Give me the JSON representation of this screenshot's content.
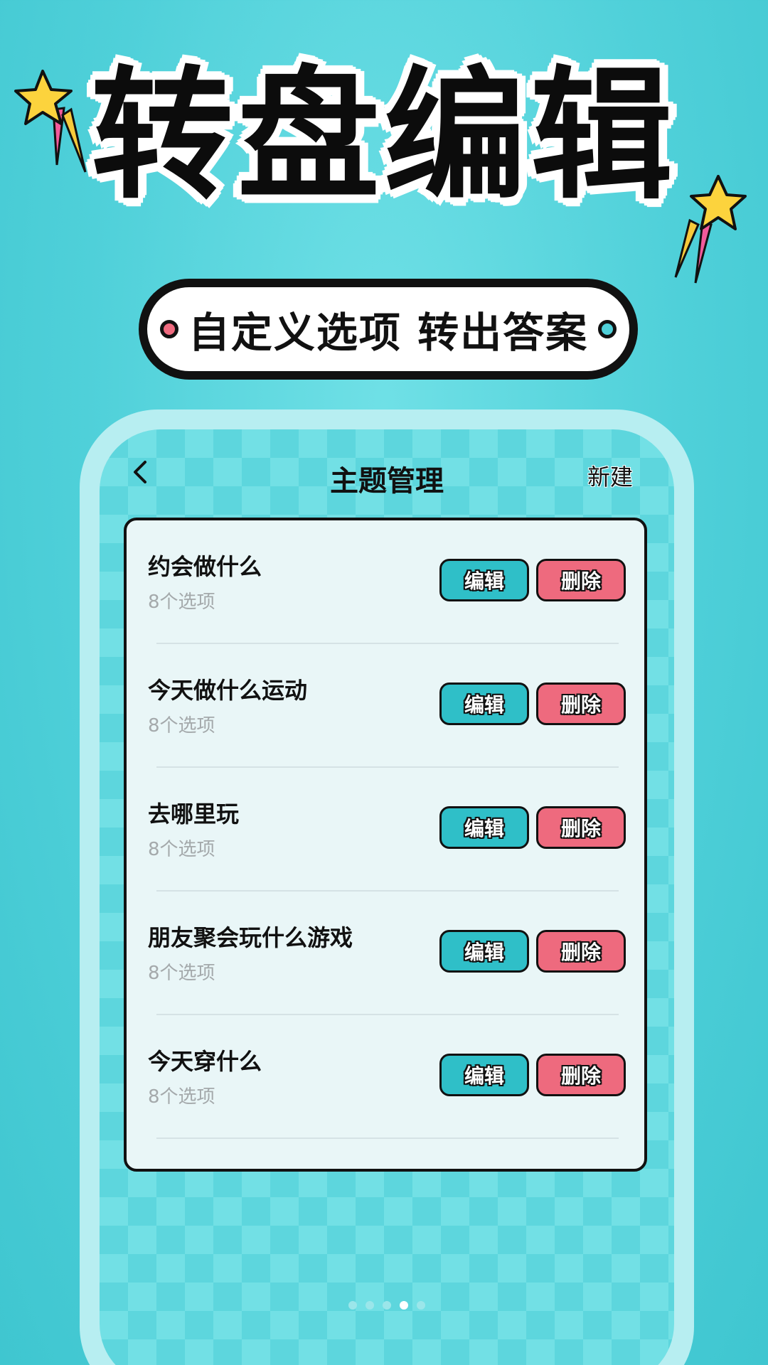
{
  "hero": {
    "title": "转盘编辑"
  },
  "subtitle": {
    "text": "自定义选项 转出答案"
  },
  "header": {
    "title": "主题管理",
    "new_label": "新建",
    "back_icon": "chevron-left-icon"
  },
  "themes": [
    {
      "name": "约会做什么",
      "count": "8个选项",
      "edit_label": "编辑",
      "delete_label": "删除"
    },
    {
      "name": "今天做什么运动",
      "count": "8个选项",
      "edit_label": "编辑",
      "delete_label": "删除"
    },
    {
      "name": "去哪里玩",
      "count": "8个选项",
      "edit_label": "编辑",
      "delete_label": "删除"
    },
    {
      "name": "朋友聚会玩什么游戏",
      "count": "8个选项",
      "edit_label": "编辑",
      "delete_label": "删除"
    },
    {
      "name": "今天穿什么",
      "count": "8个选项",
      "edit_label": "编辑",
      "delete_label": "删除"
    }
  ],
  "pagination": {
    "total": 5,
    "active_index": 3
  },
  "colors": {
    "background": "#4fd0d9",
    "edit_button": "#2fbfc8",
    "delete_button": "#ee6a7e",
    "star": "#fcd33d"
  }
}
